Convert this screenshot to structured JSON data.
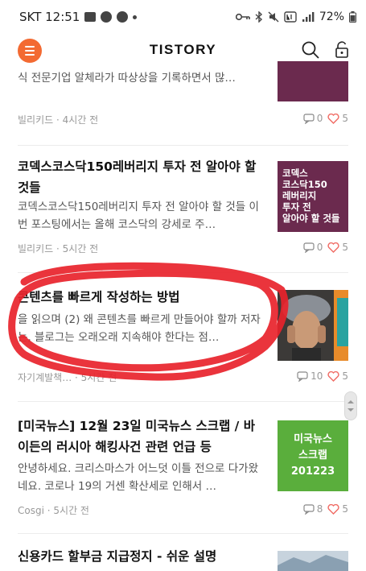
{
  "status_bar": {
    "carrier_time": "SKT 12:51",
    "battery": "72%"
  },
  "header": {
    "brand": "TISTORY"
  },
  "posts": [
    {
      "title": "",
      "excerpt": "식 전문기업 알체라가 따상상을 기록하면서 많…",
      "author": "빌리키드",
      "time": "4시간 전",
      "comments": "0",
      "likes": "5"
    },
    {
      "title": "코덱스코스닥150레버리지 투자 전 알아야 할 것들",
      "excerpt": "코덱스코스닥150레버리지 투자 전 알아야 할 것들 이번 포스팅에서는 올해 코스닥의 강세로 주…",
      "author": "빌리키드",
      "time": "5시간 전",
      "comments": "0",
      "likes": "5",
      "thumb_text": "코덱스\n코스닥150\n레버리지\n투자 전\n알아야 할 것들"
    },
    {
      "title": "콘텐츠를 빠르게 작성하는 방법",
      "excerpt": "을 읽으며 (2) 왜 콘텐츠를 빠르게 만들어야 할까 저자는, 블로그는 오래오래 지속해야 한다는 점…",
      "author": "자기계발책…",
      "time": "5시간 전",
      "comments": "10",
      "likes": "5"
    },
    {
      "title": "[미국뉴스] 12월 23일 미국뉴스 스크랩 / 바이든의 러시아 해킹사건 관련 언급 등",
      "excerpt": "안녕하세요. 크리스마스가 어느덧 이틀 전으로 다가왔네요. 코로나 19의 거센 확산세로 인해서 …",
      "author": "Cosgi",
      "time": "5시간 전",
      "comments": "8",
      "likes": "5",
      "thumb_lines": [
        "미국뉴스",
        "스크랩",
        "201223"
      ]
    },
    {
      "title": "신용카드 할부금 지급정지 - 쉬운 설명"
    }
  ],
  "colors": {
    "accent": "#f36a32",
    "heart": "#f06a63",
    "thumb_purple": "#6b2a4e",
    "thumb_green": "#5aae3c",
    "scribble": "#e8232b"
  }
}
